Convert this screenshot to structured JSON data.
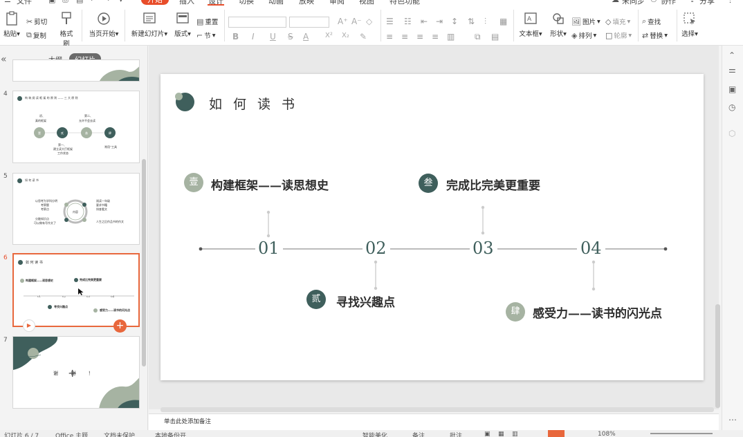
{
  "menubar": {
    "file": "文件",
    "tabs": [
      "开始",
      "插入",
      "设计",
      "切换",
      "动画",
      "放映",
      "审阅",
      "视图",
      "特色功能"
    ],
    "active_tab": "开始",
    "user": "未同步",
    "collab": "协作",
    "share": "分享"
  },
  "ribbon": {
    "paste": "粘贴",
    "cut": "剪切",
    "copy": "复制",
    "format_painter": "格式刷",
    "from_current": "当页开始",
    "new_slide": "新建幻灯片",
    "layout": "版式",
    "reset": "重置",
    "section": "节",
    "textbox": "文本框",
    "shape": "形状",
    "picture": "图片",
    "arrange": "排列",
    "fill": "填充",
    "outline": "轮廓",
    "find": "查找",
    "replace": "替换",
    "select": "选择",
    "font_buttons": [
      "B",
      "I",
      "U",
      "S",
      "A",
      "X²",
      "X₂"
    ]
  },
  "leftpanel": {
    "tab_outline": "大纲",
    "tab_slides": "幻灯片",
    "slide_numbers": [
      "4",
      "5",
      "6",
      "7"
    ],
    "selected_slide": "6",
    "thumb4": {
      "title": "构 筑 阅 读 框 架 的 原 则 —— 三 大 原 则",
      "labels": [
        "初、",
        "真的框架",
        "第二、",
        "允许不会去读",
        "第一、",
        "建立读大厅框架",
        "工作状态",
        "常用“工具"
      ],
      "nums": [
        "壹",
        "贰",
        "叁",
        "肆"
      ]
    },
    "thumb5": {
      "title": "如 何 读 书",
      "center": "内容",
      "left": [
        "以思考为学科分明",
        "考察题",
        "考察点",
        "分散知识点",
        "可以做有写作文了"
      ],
      "right": [
        "阅读一年级",
        "要求书籍",
        "排查看文",
        "人生之后作品书的作文"
      ]
    },
    "thumb6": {
      "title": "如 何 读 书",
      "items": [
        "构建框架——读思想史",
        "完成比完美更重要",
        "寻找兴趣点",
        "感受力——读书的闪光点"
      ],
      "nums": [
        "01",
        "02",
        "03",
        "04"
      ]
    },
    "thumb7": {
      "text": "谢 谢 ！"
    }
  },
  "slide": {
    "title": "如何读书",
    "items": [
      {
        "badge": "壹",
        "text": "构建框架——读思想史"
      },
      {
        "badge": "贰",
        "text": "寻找兴趣点"
      },
      {
        "badge": "叁",
        "text": "完成比完美更重要"
      },
      {
        "badge": "肆",
        "text": "感受力——读书的闪光点"
      }
    ],
    "timeline": [
      "01",
      "02",
      "03",
      "04"
    ],
    "colors": {
      "dark": "#3f5f5c",
      "light": "#a6b3a2",
      "line": "#7a7a7a"
    }
  },
  "notes": {
    "placeholder": "单击此处添加备注"
  },
  "statusbar": {
    "slide_counter": "幻灯片 6 / 7",
    "theme": "Office 主题",
    "doc_protect": "文档未保护",
    "backup": "本地备份开",
    "beautify": "智能美化",
    "notes_btn": "备注",
    "comments": "批注",
    "zoom": "108%"
  }
}
